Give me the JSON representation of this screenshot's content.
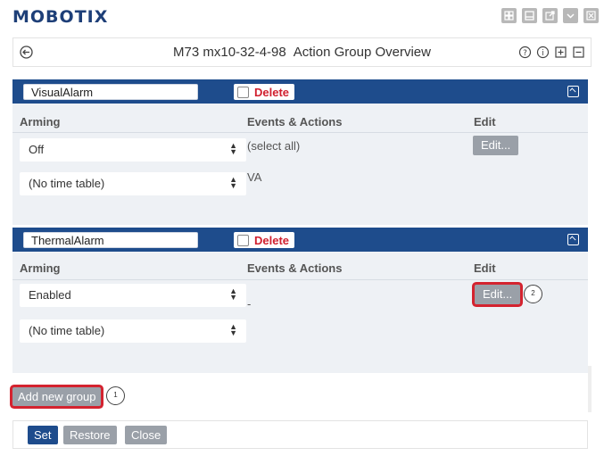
{
  "brand": "MOBOTIX",
  "header": {
    "camera": "M73 mx10-32-4-98",
    "title": "Action Group Overview"
  },
  "columns": {
    "arming": "Arming",
    "events": "Events & Actions",
    "edit": "Edit"
  },
  "groups": [
    {
      "name": "VisualAlarm",
      "delete_label": "Delete",
      "arming": "Off",
      "time_table": "(No time table)",
      "events": [
        "(select all)",
        "VA"
      ],
      "edit_label": "Edit..."
    },
    {
      "name": "ThermalAlarm",
      "delete_label": "Delete",
      "arming": "Enabled",
      "time_table": "(No time table)",
      "events": [
        "-"
      ],
      "edit_label": "Edit..."
    }
  ],
  "add_group_label": "Add new group",
  "callouts": [
    "1",
    "2"
  ],
  "footer": {
    "set": "Set",
    "restore": "Restore",
    "close": "Close"
  },
  "colors": {
    "brand": "#1e3f78",
    "header_bg": "#1e4c8c",
    "delete": "#d0202f",
    "highlight": "#d4232f",
    "button_gray": "#9aa0a8"
  }
}
